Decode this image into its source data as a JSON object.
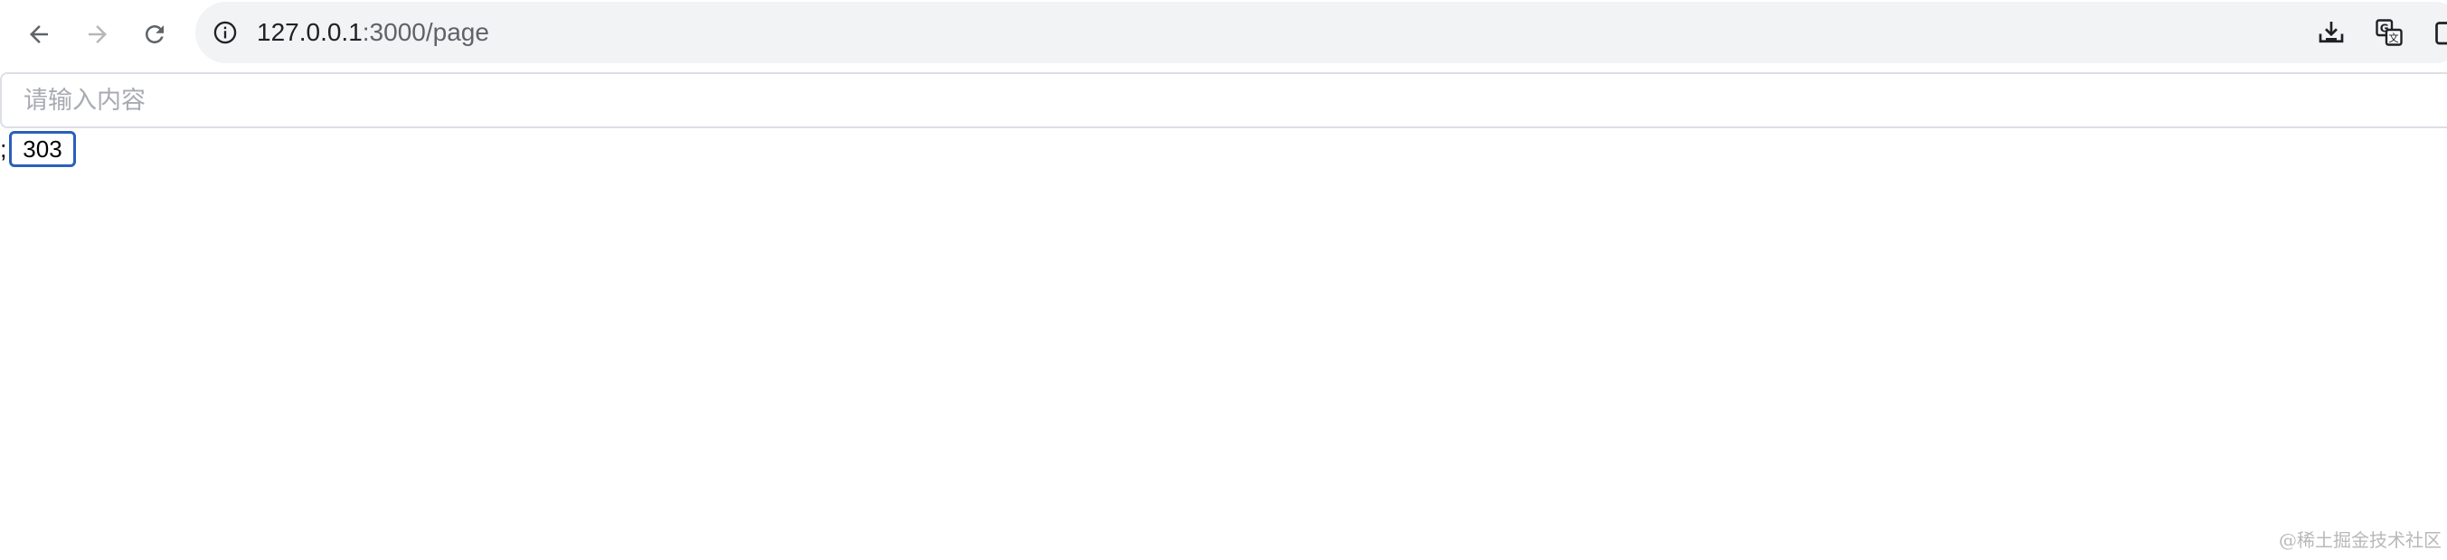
{
  "browser": {
    "url_host": "127.0.0.1",
    "url_path": ":3000/page",
    "icons": {
      "back": "back-arrow-icon",
      "forward": "forward-arrow-icon",
      "reload": "reload-icon",
      "site_info": "info-icon",
      "download": "download-icon",
      "translate": "translate-icon",
      "extension": "extension-icon"
    }
  },
  "page": {
    "input": {
      "placeholder": "请输入内容",
      "value": ""
    },
    "prefix_text": ";",
    "number_value": "303"
  },
  "watermark": "@稀土掘金技术社区",
  "colors": {
    "focus_border": "#2a5fbd",
    "input_border": "#dcdfe6",
    "placeholder": "#a8abb2",
    "omnibox_bg": "#f1f3f4"
  }
}
